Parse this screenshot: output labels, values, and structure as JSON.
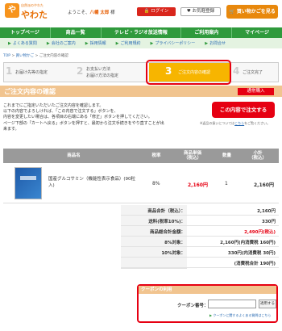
{
  "header": {
    "logo_mark": "や",
    "logo_tagline": "自然派のやわた",
    "logo_name": "やわた",
    "welcome_prefix": "ようこそ、",
    "user_name": "八幡 太郎",
    "welcome_suffix": " 様",
    "login_label": "ログイン",
    "favorites_label": "お気軽登録",
    "cart_label": "買い物かごを見る"
  },
  "nav": {
    "items": [
      "トップページ",
      "商品一覧",
      "テレビ・ラジオ放送情報",
      "ご利用案内",
      "マイページ"
    ]
  },
  "subnav": {
    "items": [
      "よくある質問",
      "会社のご案内",
      "採用情報",
      "ご利用規約",
      "プライバシーポリシー",
      "お問合せ"
    ]
  },
  "breadcrumb": {
    "home": "TOP",
    "sep": " > ",
    "cart": "買い物かご",
    "current": "ご注文内容の確認"
  },
  "steps": [
    {
      "num": "1",
      "line1": "お届け先等の指定",
      "line2": ""
    },
    {
      "num": "2",
      "line1": "お支払い方法",
      "line2": "お届け方法の指定"
    },
    {
      "num": "3",
      "line1": "ご注文内容の確認",
      "line2": ""
    },
    {
      "num": "4",
      "line1": "ご注文完了",
      "line2": ""
    }
  ],
  "section": {
    "title": "ご注文内容の確認",
    "badge": "通常購入"
  },
  "intro": {
    "lines": [
      "これまでにご指定いただいたご注文内容を確認します。",
      "以下の内容でよろしければ、「この内容で注文する」ボタンを、",
      "内容を変更したい場合は、各項目の右端にある「修正」ボタンを押してください。",
      "ページ下部の「カートへ戻る」ボタンを押すと、最初から注文手続きをやり直すことが出",
      "来ます。"
    ]
  },
  "confirm_button": "この内容で注文する",
  "note": {
    "prefix": "※返品の扱いについては",
    "link": "こちら",
    "suffix": "をご覧ください。"
  },
  "table": {
    "headers": {
      "name": "商品名",
      "rate": "税率",
      "price_1": "商品単価",
      "price_2": "（税込）",
      "qty": "数量",
      "subtotal_1": "小計",
      "subtotal_2": "（税込）"
    },
    "rows": [
      {
        "name": "国産グルコサミン（機能性表示食品）(90粒入)",
        "rate": "8%",
        "price": "2,160円",
        "qty": "1",
        "subtotal": "2,160円"
      }
    ]
  },
  "summary": {
    "product_total_label": "商品合計（税込）：",
    "product_total": "2,160円",
    "shipping_label": "送料(税率10%)：",
    "shipping": "330円",
    "grand_total_label": "商品総合計金額：",
    "grand_total": "2,490円(税込)",
    "rate8_label": "8%対象：",
    "rate8": "2,160円(内消費税 160円)",
    "rate10_label": "10%対象：",
    "rate10": "330円(内消費税 30円)",
    "tax_total": "(消費税合計 190円)"
  },
  "coupon": {
    "heading": "クーポンの利用",
    "label": "クーポン番号：",
    "input_value": "",
    "apply_button": "適用する",
    "note": "クーポンに関するよくある質問はこちら"
  }
}
